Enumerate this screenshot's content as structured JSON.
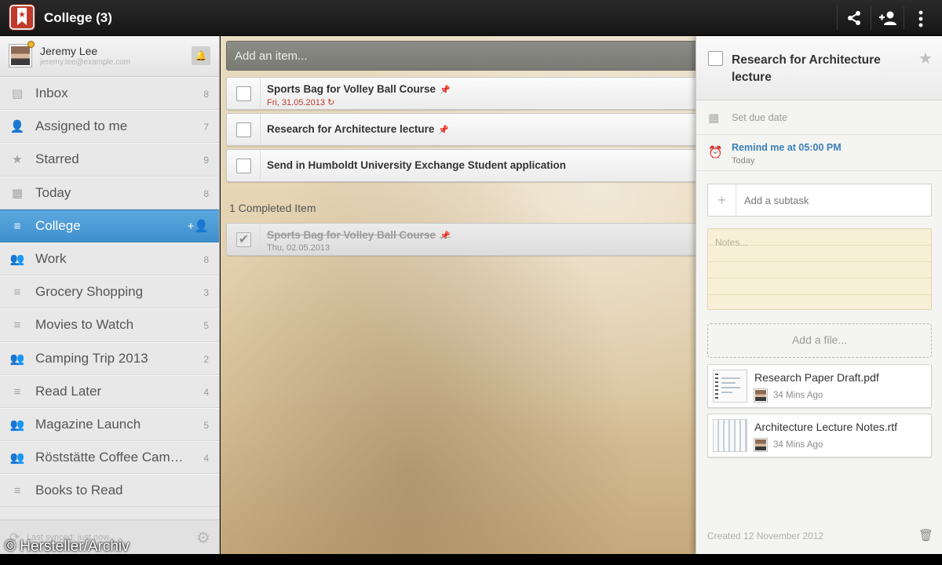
{
  "header": {
    "title": "College (3)",
    "share_icon": "share-icon",
    "add_member_icon": "add-member-icon",
    "overflow_icon": "overflow-menu-icon"
  },
  "user": {
    "name": "Jeremy Lee",
    "email": "jeremy.lee@example.com"
  },
  "sidebar": {
    "items": [
      {
        "label": "Inbox",
        "count": "8",
        "icon": "inbox-icon",
        "glyph": "▤"
      },
      {
        "label": "Assigned to me",
        "count": "7",
        "icon": "assigned-icon",
        "glyph": "👤"
      },
      {
        "label": "Starred",
        "count": "9",
        "icon": "star-icon",
        "glyph": "★"
      },
      {
        "label": "Today",
        "count": "8",
        "icon": "calendar-icon",
        "glyph": "▦"
      },
      {
        "label": "College",
        "count": "+👤",
        "icon": "list-icon",
        "glyph": "≡",
        "active": true
      },
      {
        "label": "Work",
        "count": "8",
        "icon": "shared-list-icon",
        "glyph": "👥"
      },
      {
        "label": "Grocery Shopping",
        "count": "3",
        "icon": "list-icon",
        "glyph": "≡"
      },
      {
        "label": "Movies to Watch",
        "count": "5",
        "icon": "list-icon",
        "glyph": "≡"
      },
      {
        "label": "Camping Trip 2013",
        "count": "2",
        "icon": "shared-list-icon",
        "glyph": "👥"
      },
      {
        "label": "Read Later",
        "count": "4",
        "icon": "list-icon",
        "glyph": "≡"
      },
      {
        "label": "Magazine Launch",
        "count": "5",
        "icon": "shared-list-icon",
        "glyph": "👥"
      },
      {
        "label": "Röststätte Coffee Cam…",
        "count": "4",
        "icon": "shared-list-icon",
        "glyph": "👥"
      },
      {
        "label": "Books to Read",
        "count": "",
        "icon": "list-icon",
        "glyph": "≡"
      }
    ],
    "sync_text": "Last synced: just now"
  },
  "main": {
    "add_placeholder": "Add an item...",
    "tasks": [
      {
        "title": "Sports Bag for Volley Ball Course",
        "date": "Fri, 31.05.2013",
        "pinned": true,
        "repeat": true
      },
      {
        "title": "Research for Architecture lecture",
        "date": "",
        "pinned": true
      },
      {
        "title": "Send in Humboldt University Exchange Student application",
        "date": "",
        "pinned": false
      }
    ],
    "completed_header": "1 Completed Item",
    "completed": [
      {
        "title": "Sports Bag for Volley Ball Course",
        "date": "Thu, 02.05.2013",
        "pinned": true
      }
    ]
  },
  "detail": {
    "title": "Research for Architecture lecture",
    "due_label": "Set due date",
    "remind_label": "Remind me at 05:00 PM",
    "remind_sub": "Today",
    "subtask_placeholder": "Add a subtask",
    "notes_placeholder": "Notes...",
    "add_file_label": "Add a file...",
    "files": [
      {
        "name": "Research Paper Draft.pdf",
        "time": "34 Mins Ago"
      },
      {
        "name": "Architecture Lecture Notes.rtf",
        "time": "34 Mins Ago"
      }
    ],
    "created": "Created 12 November 2012"
  },
  "watermark": "© Hersteller/Archiv",
  "colors": {
    "accent": "#4a9ad8",
    "overdue": "#c0392b",
    "reminder": "#3b7fb8"
  }
}
